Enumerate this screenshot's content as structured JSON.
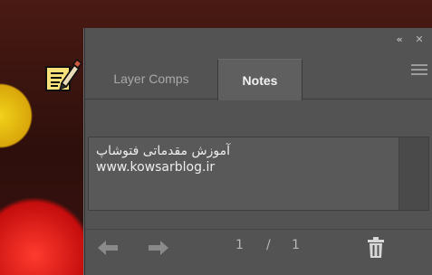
{
  "panel": {
    "collapse_label": "«",
    "close_label": "✕",
    "tabs": [
      {
        "label": "Layer Comps",
        "active": false
      },
      {
        "label": "Notes",
        "active": true
      }
    ]
  },
  "note": {
    "lines": [
      "آموزش مقدماتی فتوشاپ",
      "www.kowsarblog.ir"
    ]
  },
  "navigation": {
    "current_page": "1",
    "separator": "/",
    "total_pages": "1"
  },
  "colors": {
    "panel_bg": "#535353",
    "active_tab_bg": "#5f5f5f",
    "text": "#ededed"
  },
  "icons": {
    "note_tool": "note-tool-icon",
    "previous": "arrow-left-icon",
    "next": "arrow-right-icon",
    "delete": "trash-icon",
    "menu": "panel-menu-icon"
  }
}
